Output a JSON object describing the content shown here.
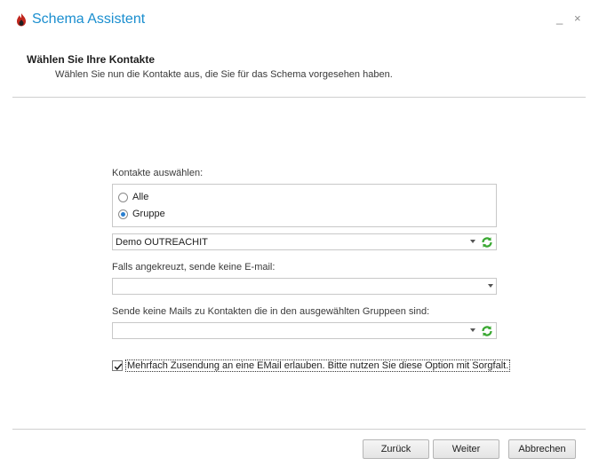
{
  "window": {
    "title": "Schema Assistent",
    "minimize_glyph": "_",
    "close_glyph": "×",
    "accent_color": "#1a8ecf",
    "logo_icon": "flame-logo-icon"
  },
  "header": {
    "title": "Wählen Sie Ihre Kontakte",
    "subtitle": "Wählen Sie nun die Kontakte aus, die Sie für das Schema vorgesehen haben."
  },
  "form": {
    "select_contacts_label": "Kontakte auswählen:",
    "radio_options": [
      {
        "label": "Alle",
        "checked": false
      },
      {
        "label": "Gruppe",
        "checked": true
      }
    ],
    "group_combo_value": "Demo OUTREACHIT",
    "no_email_label": "Falls angekreuzt, sende keine E-mail:",
    "no_email_combo_value": "",
    "exclude_groups_label": "Sende keine Mails zu Kontakten die in den ausgewählten Gruppeen sind:",
    "exclude_groups_combo_value": "",
    "multi_send_checked": true,
    "multi_send_label": "Mehrfach Zusendung an eine EMail erlauben. Bitte nutzen Sie diese Option mit Sorgfalt."
  },
  "buttons": {
    "back": "Zurück",
    "next": "Weiter",
    "cancel": "Abbrechen"
  }
}
